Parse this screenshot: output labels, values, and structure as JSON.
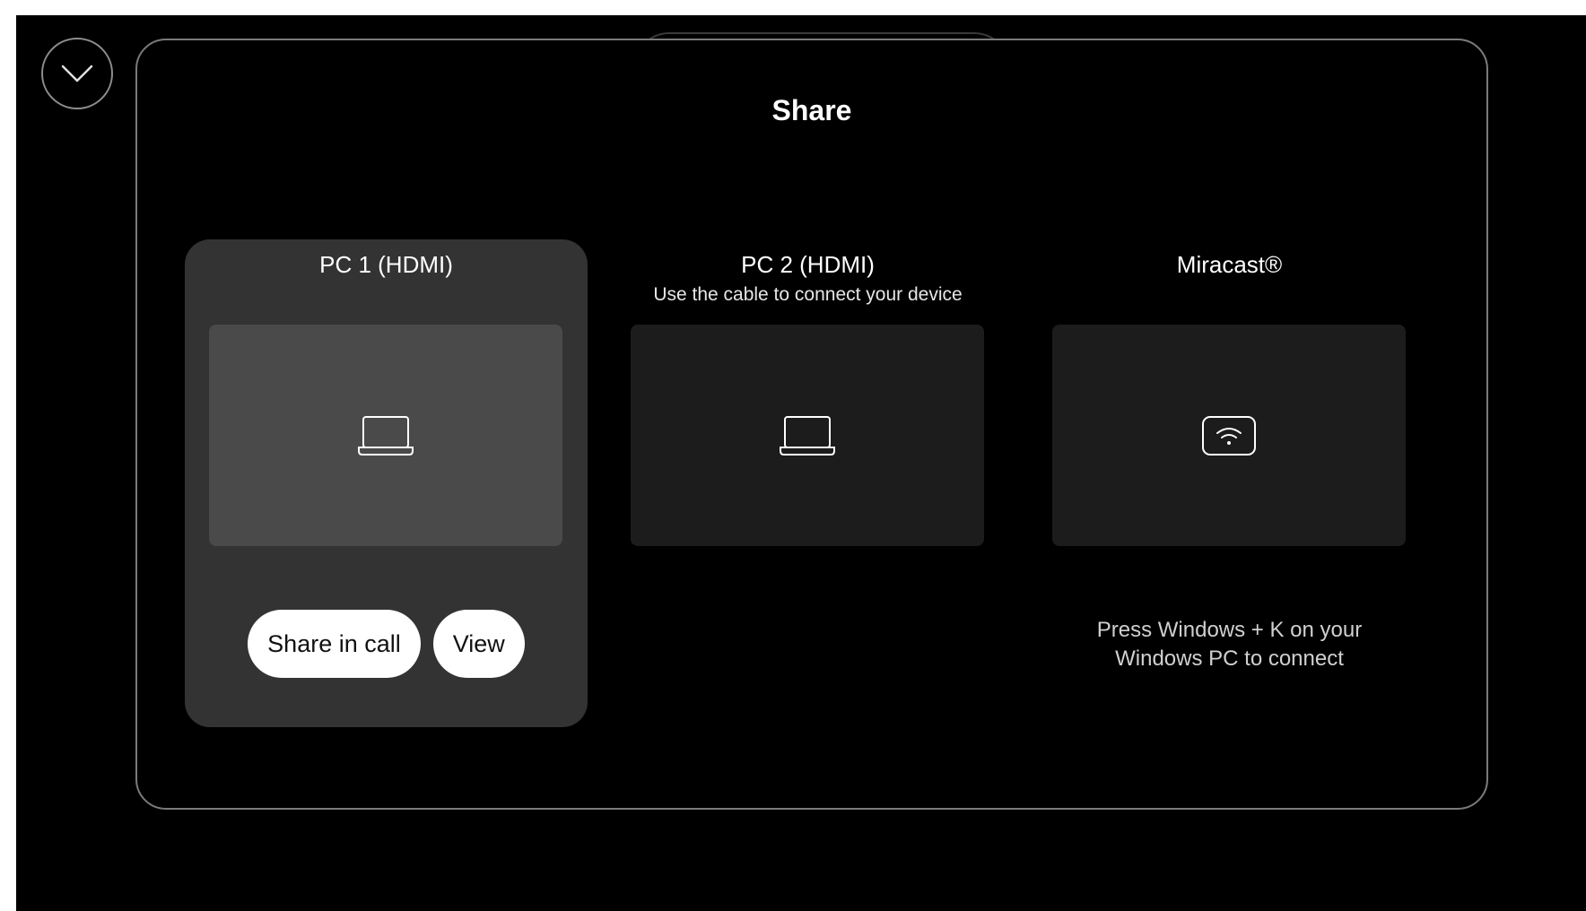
{
  "share": {
    "title": "Share",
    "sources": [
      {
        "title": "PC 1 (HDMI)",
        "subtitle": "",
        "icon": "laptop-icon",
        "selected": true,
        "buttons": [
          "Share in call",
          "View"
        ]
      },
      {
        "title": "PC 2 (HDMI)",
        "subtitle": "Use the cable to connect your device",
        "icon": "laptop-icon",
        "selected": false
      },
      {
        "title": "Miracast®",
        "subtitle": "",
        "icon": "wifi-icon",
        "selected": false,
        "hint": "Press Windows + K on your\nWindows PC to connect"
      }
    ]
  },
  "colors": {
    "background": "#000000",
    "selected_card": "#333333",
    "button": "#ffffff",
    "panel_border": "#7a7a7a"
  },
  "icons": {
    "collapse": "chevron-down-icon"
  }
}
